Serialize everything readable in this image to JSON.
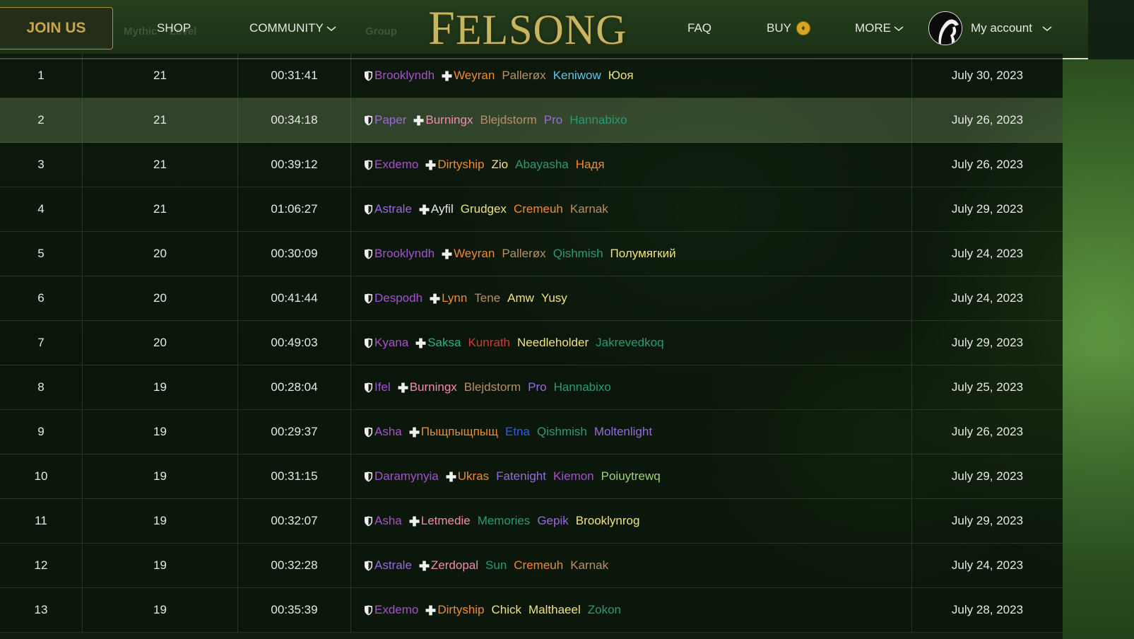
{
  "header": {
    "join_label": "JOIN US",
    "ghost_mythic": "Mythic",
    "ghost_level": "Level",
    "ghost_group": "Group",
    "shop_label": "SHOP",
    "community_label": "COMMUNITY",
    "logo_first": "F",
    "logo_rest": "ELSONG",
    "faq_label": "FAQ",
    "buy_label": "BUY",
    "more_label": "MORE",
    "account_label": "My account"
  },
  "colors": {
    "priest": "#e8e8e8",
    "warlock": "#9a6ad8",
    "monk": "#1eb98a",
    "druid": "#f08a30",
    "mage": "#5fc4e8",
    "paladin": "#ef8db0",
    "rogue": "#f2e37a",
    "evoker": "#2a9a78",
    "demonhunter": "#a84fd0",
    "warrior": "#b89068",
    "hunter": "#9fd470",
    "shaman": "#2f5fe0",
    "deathknight": "#d03a3a"
  },
  "runs": [
    {
      "rank": "1",
      "level": "21",
      "time": "00:31:41",
      "date": "July 30, 2023",
      "members": [
        {
          "name": "Brooklyndh",
          "cls": "demonhunter",
          "role": "tank"
        },
        {
          "name": "Weyran",
          "cls": "druid",
          "role": "heal"
        },
        {
          "name": "Pallerøx",
          "cls": "warrior"
        },
        {
          "name": "Keniwow",
          "cls": "mage"
        },
        {
          "name": "Юоя",
          "cls": "rogue"
        }
      ]
    },
    {
      "rank": "2",
      "level": "21",
      "time": "00:34:18",
      "date": "July 26, 2023",
      "members": [
        {
          "name": "Paper",
          "cls": "warlock",
          "role": "tank"
        },
        {
          "name": "Burningx",
          "cls": "paladin",
          "role": "heal"
        },
        {
          "name": "Blejdstorm",
          "cls": "warrior"
        },
        {
          "name": "Pro",
          "cls": "warlock"
        },
        {
          "name": "Hannabixo",
          "cls": "evoker"
        }
      ]
    },
    {
      "rank": "3",
      "level": "21",
      "time": "00:39:12",
      "date": "July 26, 2023",
      "members": [
        {
          "name": "Exdemo",
          "cls": "demonhunter",
          "role": "tank"
        },
        {
          "name": "Dirtyship",
          "cls": "druid",
          "role": "heal"
        },
        {
          "name": "Zio",
          "cls": "rogue"
        },
        {
          "name": "Abayasha",
          "cls": "evoker"
        },
        {
          "name": "Надя",
          "cls": "druid"
        }
      ]
    },
    {
      "rank": "4",
      "level": "21",
      "time": "01:06:27",
      "date": "July 29, 2023",
      "members": [
        {
          "name": "Astrale",
          "cls": "warlock",
          "role": "tank"
        },
        {
          "name": "Ayfil",
          "cls": "priest",
          "role": "heal"
        },
        {
          "name": "Grudgex",
          "cls": "rogue"
        },
        {
          "name": "Cremeuh",
          "cls": "druid"
        },
        {
          "name": "Karnak",
          "cls": "warrior"
        }
      ]
    },
    {
      "rank": "5",
      "level": "20",
      "time": "00:30:09",
      "date": "July 24, 2023",
      "members": [
        {
          "name": "Brooklyndh",
          "cls": "demonhunter",
          "role": "tank"
        },
        {
          "name": "Weyran",
          "cls": "druid",
          "role": "heal"
        },
        {
          "name": "Pallerøx",
          "cls": "warrior"
        },
        {
          "name": "Qishmish",
          "cls": "evoker"
        },
        {
          "name": "Полумягкий",
          "cls": "rogue"
        }
      ]
    },
    {
      "rank": "6",
      "level": "20",
      "time": "00:41:44",
      "date": "July 24, 2023",
      "members": [
        {
          "name": "Despodh",
          "cls": "demonhunter",
          "role": "tank"
        },
        {
          "name": "Lynn",
          "cls": "druid",
          "role": "heal"
        },
        {
          "name": "Tene",
          "cls": "warrior"
        },
        {
          "name": "Amw",
          "cls": "rogue"
        },
        {
          "name": "Yusy",
          "cls": "rogue"
        }
      ]
    },
    {
      "rank": "7",
      "level": "20",
      "time": "00:49:03",
      "date": "July 29, 2023",
      "members": [
        {
          "name": "Kyana",
          "cls": "demonhunter",
          "role": "tank"
        },
        {
          "name": "Saksa",
          "cls": "monk",
          "role": "heal"
        },
        {
          "name": "Kunrath",
          "cls": "deathknight"
        },
        {
          "name": "Needleholder",
          "cls": "rogue"
        },
        {
          "name": "Jakrevedkoq",
          "cls": "evoker"
        }
      ]
    },
    {
      "rank": "8",
      "level": "19",
      "time": "00:28:04",
      "date": "July 25, 2023",
      "members": [
        {
          "name": "Ifel",
          "cls": "demonhunter",
          "role": "tank"
        },
        {
          "name": "Burningx",
          "cls": "paladin",
          "role": "heal"
        },
        {
          "name": "Blejdstorm",
          "cls": "warrior"
        },
        {
          "name": "Pro",
          "cls": "warlock"
        },
        {
          "name": "Hannabixo",
          "cls": "evoker"
        }
      ]
    },
    {
      "rank": "9",
      "level": "19",
      "time": "00:29:37",
      "date": "July 26, 2023",
      "members": [
        {
          "name": "Asha",
          "cls": "demonhunter",
          "role": "tank"
        },
        {
          "name": "Пыщпыщпыщ",
          "cls": "druid",
          "role": "heal"
        },
        {
          "name": "Etna",
          "cls": "shaman"
        },
        {
          "name": "Qishmish",
          "cls": "evoker"
        },
        {
          "name": "Moltenlight",
          "cls": "warlock"
        }
      ]
    },
    {
      "rank": "10",
      "level": "19",
      "time": "00:31:15",
      "date": "July 29, 2023",
      "members": [
        {
          "name": "Daramynyia",
          "cls": "demonhunter",
          "role": "tank"
        },
        {
          "name": "Ukras",
          "cls": "druid",
          "role": "heal"
        },
        {
          "name": "Fatenight",
          "cls": "warlock"
        },
        {
          "name": "Kiemon",
          "cls": "demonhunter"
        },
        {
          "name": "Poiuytrewq",
          "cls": "hunter"
        }
      ]
    },
    {
      "rank": "11",
      "level": "19",
      "time": "00:32:07",
      "date": "July 29, 2023",
      "members": [
        {
          "name": "Asha",
          "cls": "demonhunter",
          "role": "tank"
        },
        {
          "name": "Letmedie",
          "cls": "paladin",
          "role": "heal"
        },
        {
          "name": "Memories",
          "cls": "evoker"
        },
        {
          "name": "Gepik",
          "cls": "warlock"
        },
        {
          "name": "Brooklynrog",
          "cls": "rogue"
        }
      ]
    },
    {
      "rank": "12",
      "level": "19",
      "time": "00:32:28",
      "date": "July 24, 2023",
      "members": [
        {
          "name": "Astrale",
          "cls": "warlock",
          "role": "tank"
        },
        {
          "name": "Zerdopal",
          "cls": "paladin",
          "role": "heal"
        },
        {
          "name": "Sun",
          "cls": "evoker"
        },
        {
          "name": "Cremeuh",
          "cls": "druid"
        },
        {
          "name": "Karnak",
          "cls": "warrior"
        }
      ]
    },
    {
      "rank": "13",
      "level": "19",
      "time": "00:35:39",
      "date": "July 28, 2023",
      "members": [
        {
          "name": "Exdemo",
          "cls": "demonhunter",
          "role": "tank"
        },
        {
          "name": "Dirtyship",
          "cls": "druid",
          "role": "heal"
        },
        {
          "name": "Chick",
          "cls": "rogue"
        },
        {
          "name": "Malthaeel",
          "cls": "rogue"
        },
        {
          "name": "Zokon",
          "cls": "evoker"
        }
      ]
    }
  ]
}
